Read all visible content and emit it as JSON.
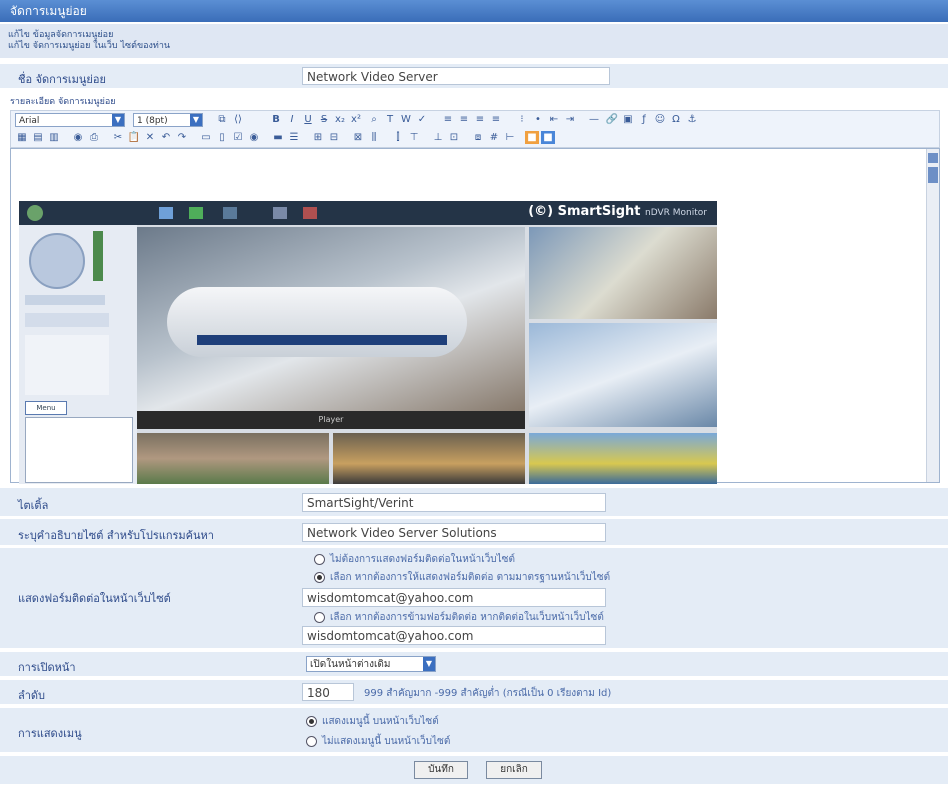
{
  "header": {
    "title": "จัดการเมนูย่อย"
  },
  "sub_links": [
    "แก้ไข ข้อมูลจัดการเมนูย่อย",
    "แก้ไข จัดการเมนูย่อย ในเว็บ ไซต์ของท่าน"
  ],
  "menu_name": {
    "label": "ชื่อ จัดการเมนูย่อย",
    "value": "Network Video Server"
  },
  "editor": {
    "label": "รายละเอียด จัดการเมนูย่อย",
    "font_select": "Arial",
    "size_select": "1 (8pt)",
    "embedded": {
      "brand": "(©) SmartSight",
      "brand_sub": "nDVR Monitor",
      "center_caption": "Player",
      "menu_button": "Menu"
    }
  },
  "fields": {
    "title": {
      "label": "ไตเติ้ล",
      "value": "SmartSight/Verint"
    },
    "description": {
      "label": "ระบุคำอธิบายไซต์ สำหรับโปรแกรมค้นหา",
      "value": "Network Video Server Solutions"
    },
    "contact": {
      "label": "แสดงฟอร์มติดต่อในหน้าเว็บไซต์",
      "options": [
        "ไม่ต้องการแสดงฟอร์มติดต่อในหน้าเว็บไซต์",
        "เลือก หากต้องการให้แสดงฟอร์มติดต่อ ตามมาตรฐานหน้าเว็บไซต์",
        "เลือก หากต้องการข้ามฟอร์มติดต่อ หากติดต่อในเว็บหน้าเว็บไซต์"
      ],
      "email_1": "wisdomtomcat@yahoo.com",
      "email_2": "wisdomtomcat@yahoo.com"
    },
    "open_page": {
      "label": "การเปิดหน้า",
      "value": "เปิดในหน้าต่างเดิม"
    },
    "order": {
      "label": "ลำดับ",
      "value": "180",
      "hint": "999 สำคัญมาก -999 สำคัญต่ำ (กรณีเป็น 0 เรียงตาม Id)"
    },
    "display": {
      "label": "การแสดงเมนู",
      "options": [
        "แสดงเมนูนี้ บนหน้าเว็บไซต์",
        "ไม่แสดงเมนูนี้ บนหน้าเว็บไซต์"
      ]
    }
  },
  "buttons": {
    "save": "บันทึก",
    "cancel": "ยกเลิก"
  }
}
